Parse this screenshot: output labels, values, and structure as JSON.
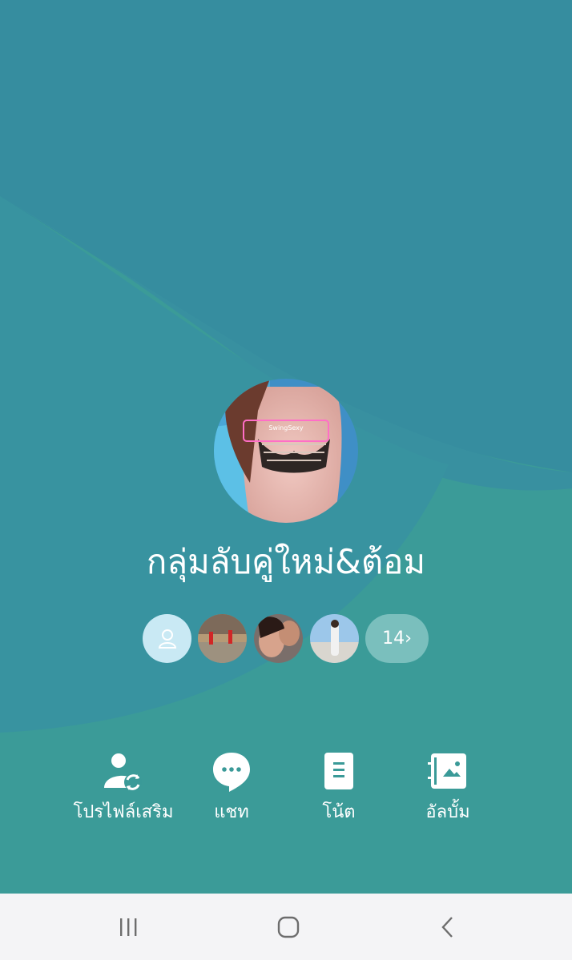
{
  "group": {
    "name": "กลุ่มลับคู่ใหม่&ต้อม"
  },
  "members": {
    "more_label": "14›"
  },
  "actions": [
    {
      "label": "โปรไฟล์เสริม",
      "icon": "profile-switch-icon"
    },
    {
      "label": "แชท",
      "icon": "chat-icon"
    },
    {
      "label": "โน้ต",
      "icon": "note-icon"
    },
    {
      "label": "อัลบั้ม",
      "icon": "album-icon"
    }
  ],
  "navbar": {
    "recent": "recent-apps-icon",
    "home": "home-icon",
    "back": "back-icon"
  },
  "colors": {
    "background": "#3b9b98",
    "cover_shape": "#368d9f",
    "navbar": "#f4f4f6"
  }
}
